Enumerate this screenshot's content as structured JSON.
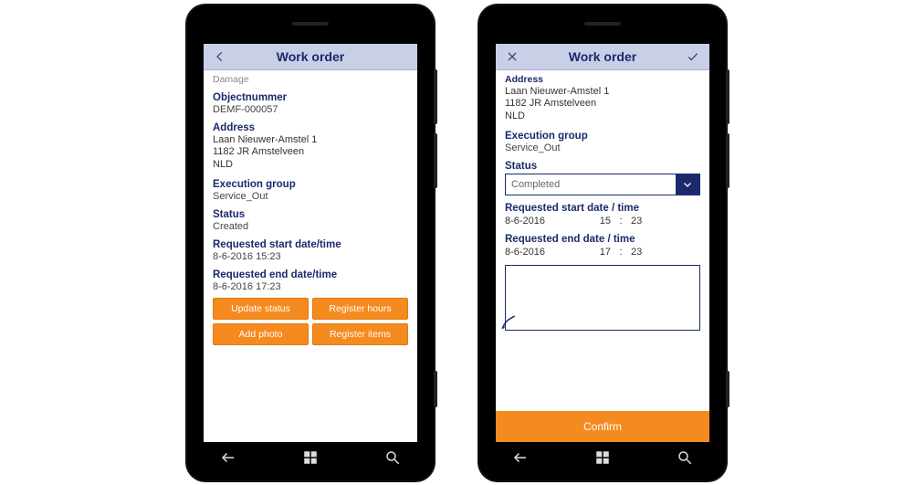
{
  "left": {
    "header": {
      "title": "Work order"
    },
    "truncated_top": "Damage",
    "objectnummer": {
      "label": "Objectnummer",
      "value": "DEMF-000057"
    },
    "address": {
      "label": "Address",
      "line1": "Laan Nieuwer-Amstel 1",
      "line2": "1182 JR Amstelveen",
      "line3": "NLD"
    },
    "execution_group": {
      "label": "Execution group",
      "value": "Service_Out"
    },
    "status": {
      "label": "Status",
      "value": "Created"
    },
    "req_start": {
      "label": "Requested start date/time",
      "value": "8-6-2016 15:23"
    },
    "req_end": {
      "label": "Requested end date/time",
      "value": "8-6-2016 17:23"
    },
    "buttons": {
      "update_status": "Update status",
      "register_hours": "Register hours",
      "add_photo": "Add photo",
      "register_items": "Register items"
    }
  },
  "right": {
    "header": {
      "title": "Work order"
    },
    "address_truncated_label": "Address",
    "address": {
      "line1": "Laan Nieuwer-Amstel 1",
      "line2": "1182 JR Amstelveen",
      "line3": "NLD"
    },
    "execution_group": {
      "label": "Execution group",
      "value": "Service_Out"
    },
    "status": {
      "label": "Status",
      "value": "Completed"
    },
    "req_start": {
      "label": "Requested start date / time",
      "date": "8-6-2016",
      "h": "15",
      "sep": ":",
      "m": "23"
    },
    "req_end": {
      "label": "Requested end date / time",
      "date": "8-6-2016",
      "h": "17",
      "sep": ":",
      "m": "23"
    },
    "confirm": "Confirm"
  },
  "colors": {
    "accent": "#f58a1f",
    "navy": "#1a2a6c",
    "header_bg": "#c8cfe6"
  }
}
